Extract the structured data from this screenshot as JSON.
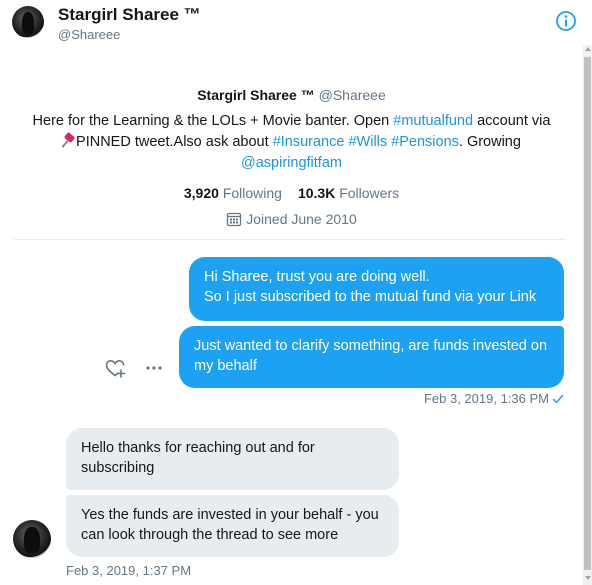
{
  "header": {
    "name": "Stargirl Sharee ™",
    "handle": "@Shareee"
  },
  "profile": {
    "name": "Stargirl Sharee ™",
    "handle": "@Shareee",
    "bio": {
      "part1": "Here for the Learning & the LOLs + Movie banter. Open ",
      "tag_mutualfund": "#mutualfund",
      "part2": " account via ",
      "pinned": "PINNED tweet.Also ask about ",
      "tag_insurance": "#Insurance",
      "space1": " ",
      "tag_wills": "#Wills",
      "space2": " ",
      "tag_pensions": "#Pensions",
      "part3": ". Growing ",
      "mention": "@aspiringfitfam"
    },
    "following_count": "3,920",
    "following_label": "Following",
    "followers_count": "10.3K",
    "followers_label": "Followers",
    "joined": "Joined June 2010"
  },
  "messages": {
    "sent1_line1": "Hi Sharee, trust you are doing well.",
    "sent1_line2": "So I just subscribed to the mutual fund via your Link",
    "sent2": "Just wanted to clarify something, are funds invested on my behalf",
    "sent_timestamp": "Feb 3, 2019, 1:36 PM",
    "recv1": "Hello thanks for reaching out and for subscribing",
    "recv2": "Yes the funds are invested in your behalf - you can look through the thread to see more",
    "recv_timestamp": "Feb 3, 2019, 1:37 PM"
  },
  "icons": {
    "info": "info-icon",
    "heart_add": "heart-plus-icon",
    "more": "more-dots-icon",
    "calendar": "calendar-icon",
    "pin": "pushpin-icon",
    "read_check": "check-icon"
  },
  "colors": {
    "accent": "#1da1f2",
    "link": "#1b95e0",
    "received_bubble": "#e6ecf0",
    "secondary_text": "#657786"
  }
}
